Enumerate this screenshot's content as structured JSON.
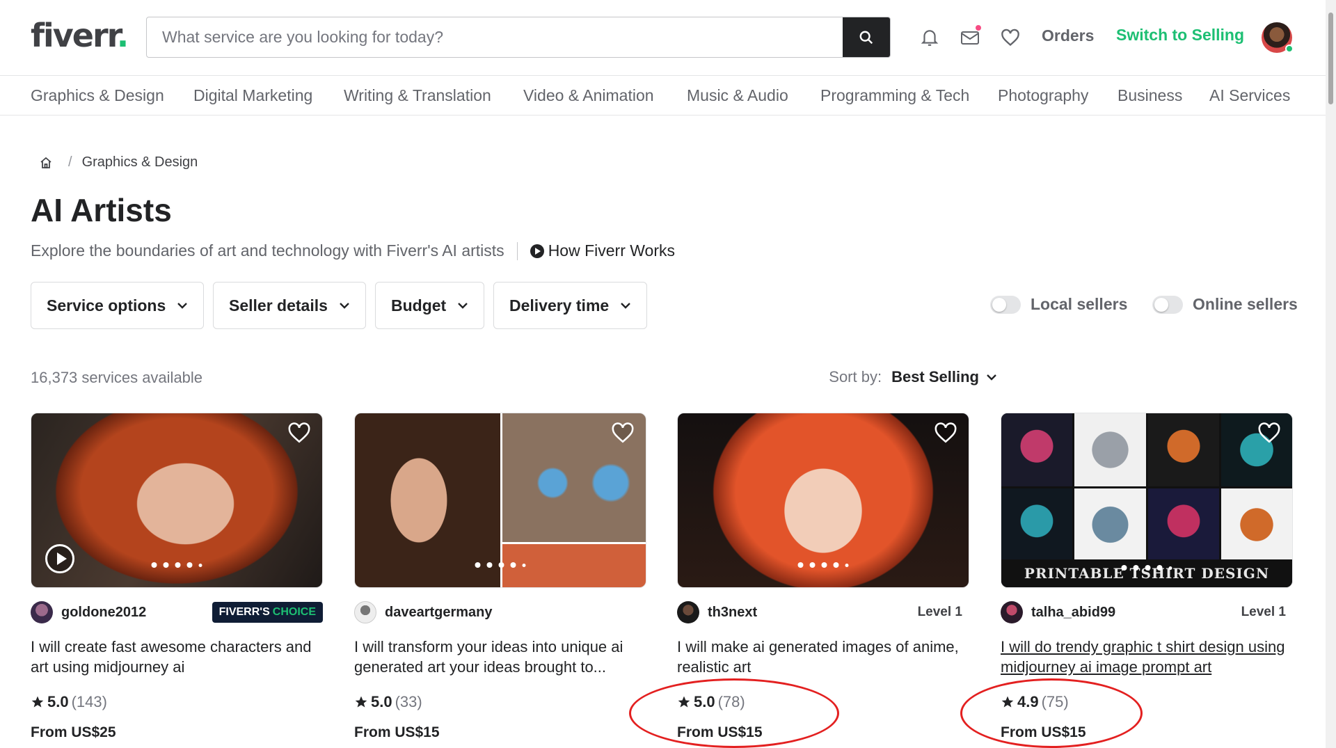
{
  "header": {
    "logo_text": "fiverr",
    "logo_dot": ".",
    "search_placeholder": "What service are you looking for today?",
    "orders_label": "Orders",
    "switch_label": "Switch to Selling"
  },
  "categories": [
    "Graphics & Design",
    "Digital Marketing",
    "Writing & Translation",
    "Video & Animation",
    "Music & Audio",
    "Programming & Tech",
    "Photography",
    "Business",
    "AI Services"
  ],
  "breadcrumb": {
    "sep": "/",
    "current": "Graphics & Design"
  },
  "page": {
    "title": "AI Artists",
    "subtitle": "Explore the boundaries of art and technology with Fiverr's AI artists",
    "how_label": "How Fiverr Works"
  },
  "filters": [
    "Service options",
    "Seller details",
    "Budget",
    "Delivery time"
  ],
  "toggles": [
    "Local sellers",
    "Online sellers"
  ],
  "results": {
    "count_text": "16,373 services available",
    "sort_label": "Sort by:",
    "sort_value": "Best Selling"
  },
  "gigs": [
    {
      "seller": "goldone2012",
      "badge_prefix": "FIVERR'S",
      "badge_suffix": "CHOICE",
      "title": "I will create fast awesome characters and art using midjourney ai",
      "rating": "5.0",
      "reviews": "(143)",
      "price": "From US$25"
    },
    {
      "seller": "daveartgermany",
      "title": "I will transform your ideas into unique ai generated art your ideas brought to...",
      "rating": "5.0",
      "reviews": "(33)",
      "price": "From US$15"
    },
    {
      "seller": "th3next",
      "level": "Level 1",
      "title": "I will make ai generated images of anime, realistic art",
      "rating": "5.0",
      "reviews": "(78)",
      "price": "From US$15"
    },
    {
      "seller": "talha_abid99",
      "level": "Level 1",
      "title": "I will do trendy graphic t shirt design using midjourney ai image prompt art",
      "thumb_text": "PRINTABLE TSHIRT DESIGN",
      "rating": "4.9",
      "reviews": "(75)",
      "price": "From US$15"
    }
  ],
  "colors": {
    "brand_green": "#1dbf73",
    "annotation_red": "#e32020",
    "dark": "#222325"
  }
}
